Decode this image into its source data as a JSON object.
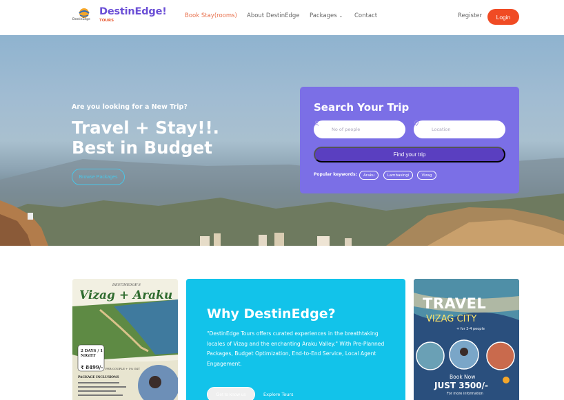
{
  "brand": {
    "name": "DestinEdge!",
    "sub": "TOURS",
    "logo_text": "DestinEdge"
  },
  "nav": {
    "items": [
      {
        "label": "Book Stay(rooms)",
        "active": true
      },
      {
        "label": "About DestinEdge",
        "active": false
      },
      {
        "label": "Packages",
        "active": false,
        "has_dropdown": true
      },
      {
        "label": "Contact",
        "active": false
      }
    ],
    "register": "Register",
    "login": "Login"
  },
  "hero": {
    "kicker": "Are you looking for a New Trip?",
    "title_line1": "Travel + Stay!!.",
    "title_line2": "Best in Budget",
    "browse_button": "Browse Packages"
  },
  "search": {
    "title": "Search Your Trip",
    "people_placeholder": "No of people",
    "location_placeholder": "Location",
    "find_button": "Find your trip",
    "popular_label": "Popular keywords:",
    "keywords": [
      "Araku",
      "Lambasingi",
      "Vizag"
    ]
  },
  "why": {
    "title": "Why DestinEdge?",
    "body": "\"DestinEdge Tours offers curated experiences in the breathtaking locales of Vizag and the enchanting Araku Valley.\" With Pre-Planned Packages, Budget Optimization, End-to-End Service, Local Agent Engagement.",
    "get_to_know": "Get to know us",
    "explore": "Explore Tours"
  },
  "poster_left": {
    "kicker": "DESTINEDGE'S",
    "title": "Vizag + Araku",
    "duration": "2 DAYS / 1 NIGHT",
    "price": "₹ 8499/-",
    "price_note": "PER COUPLE + 5% GST",
    "inclusions_label": "PACKAGE INCLUSIONS"
  },
  "poster_right": {
    "title1": "TRAVEL",
    "title2": "VIZAG CITY",
    "note": "+ for 2-4 people",
    "book_now": "Book Now",
    "price": "JUST 3500/-",
    "info": "For more information"
  },
  "colors": {
    "accent": "#f04b24",
    "brand": "#6b4fd6",
    "search_bg": "#7b6fe6",
    "why_bg": "#12c3ea"
  }
}
